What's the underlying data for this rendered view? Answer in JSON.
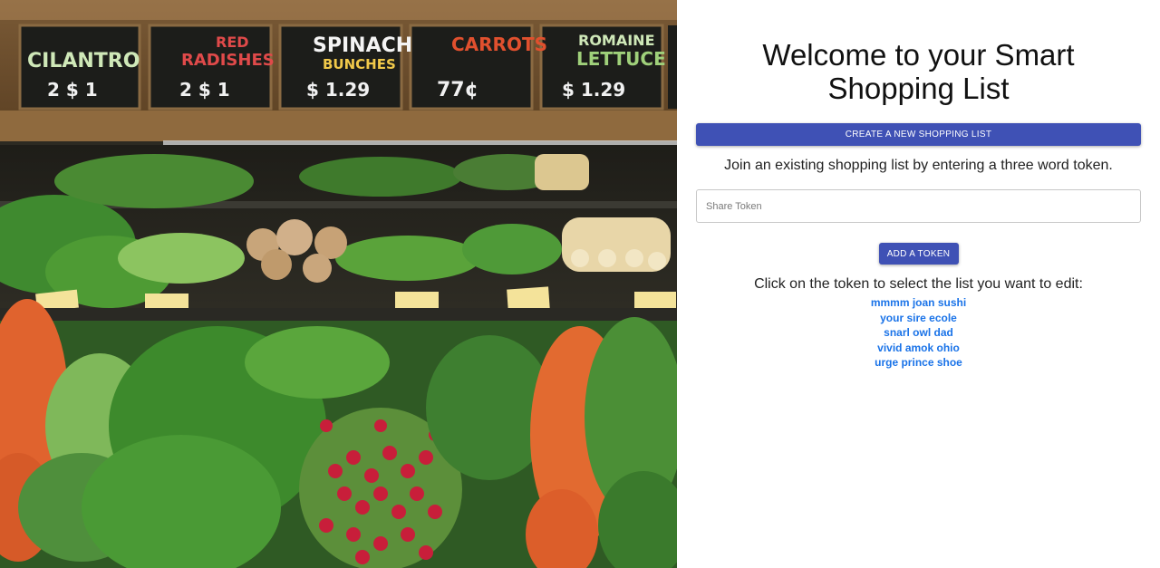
{
  "hero": {
    "signs": [
      {
        "name": "CILANTRO",
        "price": "2 $ 1"
      },
      {
        "name_top": "RED",
        "name": "RADISHES",
        "price": "2 $ 1"
      },
      {
        "name_top": "SPINACH",
        "name": "BUNCHES",
        "price": "$ 1.29"
      },
      {
        "name": "CARROTS",
        "price": "77¢"
      },
      {
        "name_top": "ROMAINE",
        "name": "LETTUCE",
        "price": "$ 1.29"
      }
    ]
  },
  "panel": {
    "title": "Welcome to your Smart Shopping List",
    "create_button_label": "CREATE A NEW SHOPPING LIST",
    "join_text": "Join an existing shopping list by entering a three word token.",
    "token_input_placeholder": "Share Token",
    "token_input_value": "",
    "add_token_button_label": "ADD A TOKEN",
    "click_text": "Click on the token to select the list you want to edit:",
    "tokens": [
      "mmmm joan sushi",
      "your sire ecole",
      "snarl owl dad",
      "vivid amok ohio",
      "urge prince shoe"
    ]
  },
  "colors": {
    "button_primary": "#3f51b5",
    "link": "#1a73e8"
  }
}
